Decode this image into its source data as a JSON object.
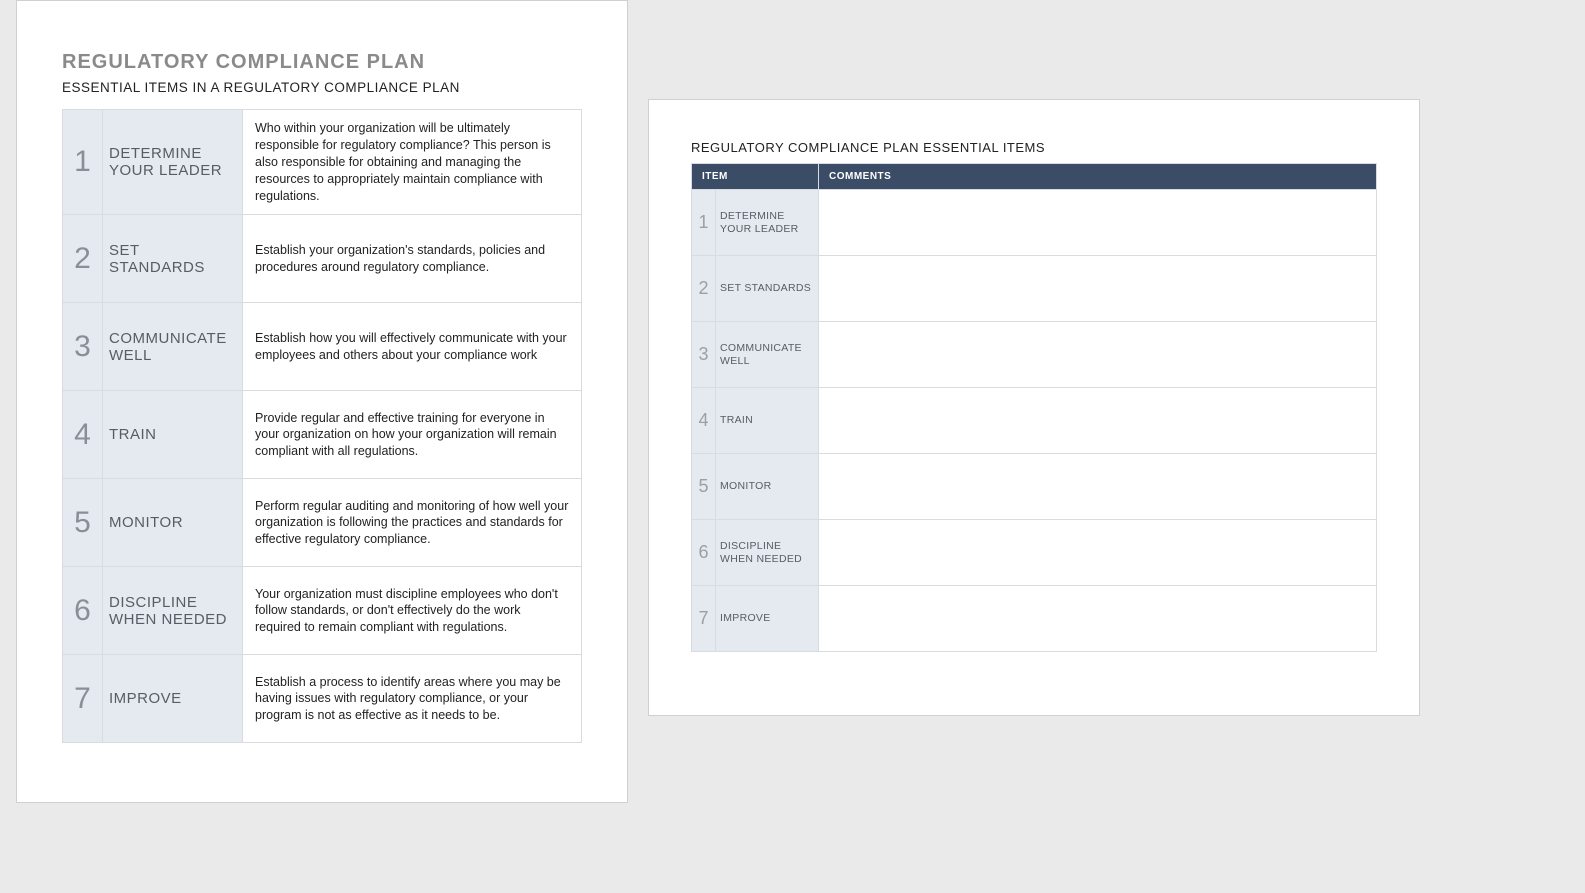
{
  "left": {
    "title": "REGULATORY COMPLIANCE PLAN",
    "subtitle": "ESSENTIAL ITEMS IN A REGULATORY COMPLIANCE PLAN",
    "rows": [
      {
        "num": "1",
        "label": "DETERMINE YOUR LEADER",
        "desc": "Who within your organization will be ultimately responsible for regulatory compliance? This person is also responsible for obtaining and managing the resources to appropriately maintain compliance with regulations."
      },
      {
        "num": "2",
        "label": "SET STANDARDS",
        "desc": "Establish your organization's standards, policies and procedures around regulatory compliance."
      },
      {
        "num": "3",
        "label": "COMMUNICATE WELL",
        "desc": "Establish how you will effectively communicate with your employees and others about your compliance work"
      },
      {
        "num": "4",
        "label": "TRAIN",
        "desc": "Provide regular and effective training for everyone in your organization on how your organization will remain compliant with all regulations."
      },
      {
        "num": "5",
        "label": "MONITOR",
        "desc": "Perform regular auditing and monitoring of how well your organization is following the practices and standards for effective regulatory compliance."
      },
      {
        "num": "6",
        "label": "DISCIPLINE WHEN NEEDED",
        "desc": "Your organization must discipline employees who don't follow standards, or don't effectively do the work required to remain compliant with regulations."
      },
      {
        "num": "7",
        "label": "IMPROVE",
        "desc": "Establish a process to identify areas where you may be having issues with regulatory compliance, or your program is not as effective as it needs to be."
      }
    ]
  },
  "right": {
    "title": "REGULATORY COMPLIANCE PLAN ESSENTIAL ITEMS",
    "header_item": "ITEM",
    "header_comments": "COMMENTS",
    "rows": [
      {
        "num": "1",
        "label": "DETERMINE YOUR LEADER",
        "comment": ""
      },
      {
        "num": "2",
        "label": "SET STANDARDS",
        "comment": ""
      },
      {
        "num": "3",
        "label": "COMMUNICATE WELL",
        "comment": ""
      },
      {
        "num": "4",
        "label": "TRAIN",
        "comment": ""
      },
      {
        "num": "5",
        "label": "MONITOR",
        "comment": ""
      },
      {
        "num": "6",
        "label": "DISCIPLINE WHEN NEEDED",
        "comment": ""
      },
      {
        "num": "7",
        "label": "IMPROVE",
        "comment": ""
      }
    ]
  }
}
